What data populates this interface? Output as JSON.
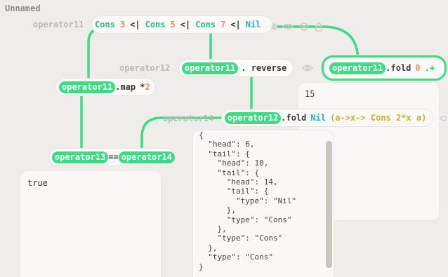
{
  "title": "Unnamed",
  "colors": {
    "wire": "#3ddc84",
    "keyword": "#27c47a",
    "number": "#f08a6a",
    "nil": "#19b8d6",
    "background": "#efedea"
  },
  "nodes": {
    "op11": {
      "label": "operator11",
      "expr": {
        "cons1": "Cons",
        "n1": "3",
        "p1": "<|",
        "cons2": "Cons",
        "n2": "5",
        "p2": "<|",
        "cons3": "Cons",
        "n3": "7",
        "p3": "<|",
        "nil": "Nil"
      }
    },
    "map": {
      "ref": "operator11",
      "method": ".map",
      "arg_op": "*",
      "arg_n": "2"
    },
    "reverse": {
      "label": "operator12",
      "ref": "operator11",
      "method": ". reverse"
    },
    "fold_top": {
      "ref": "operator11",
      "method": ".fold",
      "arg_n": "0",
      "arg_op": ".+"
    },
    "fold_nil": {
      "label": "operator14",
      "ref": "operator12",
      "method": ".fold",
      "nil": "Nil",
      "lambda": "(a->x-> Cons 2*x a)"
    },
    "eq": {
      "ref1": "operator13",
      "op": "==",
      "ref2": "operator14"
    }
  },
  "panels": {
    "fold_top_result": "15",
    "eq_result": "true",
    "json_result": "{\n  \"head\": 6,\n  \"tail\": {\n    \"head\": 10,\n    \"tail\": {\n      \"head\": 14,\n      \"tail\": {\n        \"type\": \"Nil\"\n      },\n      \"type\": \"Cons\"\n    },\n    \"type\": \"Cons\"\n  },\n  \"type\": \"Cons\"\n}"
  },
  "icons": [
    "eye-icon",
    "settings-icon",
    "lock-icon"
  ]
}
